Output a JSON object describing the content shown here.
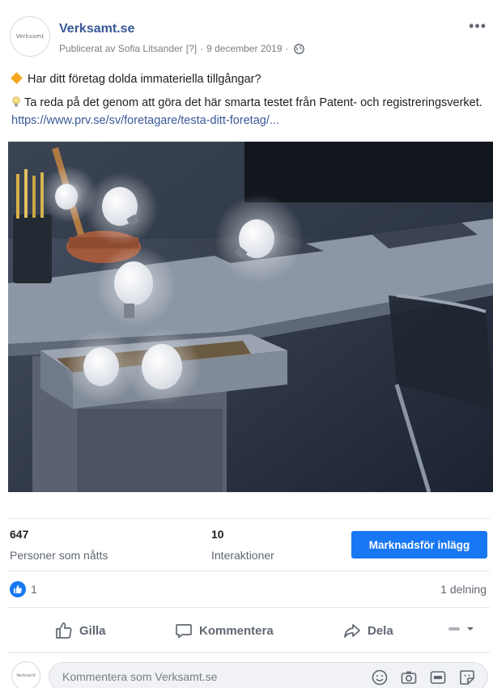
{
  "header": {
    "avatar_text": "Verksamt",
    "page_name": "Verksamt.se",
    "published_by": "Publicerat av Sofia Litsander",
    "help_marker": "[?]",
    "date": "9 december 2019",
    "separator": "·"
  },
  "post": {
    "line1": "Har ditt företag dolda immateriella tillgångar?",
    "line2_text": "Ta reda på det genom att göra det här smarta testet från Patent- och registreringsverket.",
    "link": "https://www.prv.se/sv/foretagare/testa-ditt-foretag/..."
  },
  "stats": {
    "reach_value": "647",
    "reach_label": "Personer som nåtts",
    "engagement_value": "10",
    "engagement_label": "Interaktioner",
    "boost_label": "Marknadsför inlägg"
  },
  "reactions": {
    "like_count": "1",
    "shares": "1 delning"
  },
  "actions": {
    "like_label": "Gilla",
    "comment_label": "Kommentera",
    "share_label": "Dela"
  },
  "comment": {
    "avatar_text": "Verksamt",
    "placeholder": "Kommentera som Verksamt.se"
  },
  "colors": {
    "brand_blue": "#1877f2",
    "link_blue": "#385898"
  },
  "icons": [
    "globe-icon",
    "more-icon",
    "diamond-icon",
    "lightbulb-icon",
    "like-icon",
    "comment-icon",
    "share-icon",
    "chevron-down-icon",
    "emoji-icon",
    "camera-icon",
    "gif-icon",
    "sticker-icon"
  ]
}
